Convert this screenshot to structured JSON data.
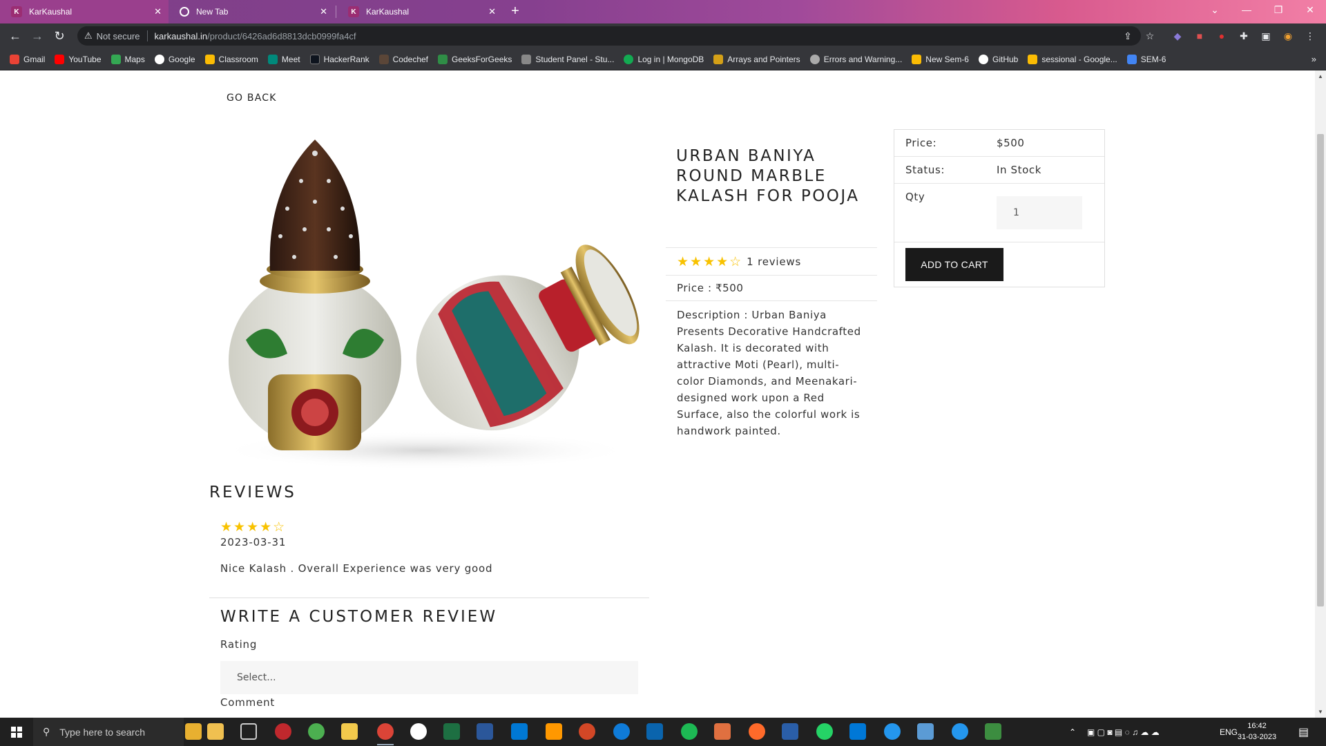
{
  "browser": {
    "tabs": [
      {
        "title": "KarKaushal",
        "active": true
      },
      {
        "title": "New Tab",
        "active": false
      },
      {
        "title": "KarKaushal",
        "active": false
      }
    ],
    "security_label": "Not secure",
    "url_host": "karkaushal.in",
    "url_path": "/product/6426ad6d8813dcb0999fa4cf",
    "bookmarks": [
      "Gmail",
      "YouTube",
      "Maps",
      "Google",
      "Classroom",
      "Meet",
      "HackerRank",
      "Codechef",
      "GeeksForGeeks",
      "Student Panel - Stu...",
      "Log in | MongoDB",
      "Arrays and Pointers",
      "Errors and Warning...",
      "New Sem-6",
      "GitHub",
      "sessional - Google...",
      "SEM-6"
    ]
  },
  "page": {
    "go_back": "GO BACK",
    "product": {
      "title": "URBAN BANIYA ROUND MARBLE KALASH FOR POOJA",
      "stars": "★★★★☆",
      "reviews_count": "1 reviews",
      "price_line": "Price : ₹500",
      "description": "Description : Urban Baniya Presents Decorative Handcrafted Kalash. It is decorated with attractive Moti (Pearl), multi-color Diamonds, and Meenakari-designed work upon a Red Surface, also the colorful work is handwork painted."
    },
    "card": {
      "price_label": "Price:",
      "price_value": "$500",
      "status_label": "Status:",
      "status_value": "In Stock",
      "qty_label": "Qty",
      "qty_value": "1",
      "add_to_cart": "ADD TO CART"
    },
    "reviews": {
      "heading": "REVIEWS",
      "items": [
        {
          "stars": "★★★★☆",
          "date": "2023-03-31",
          "comment": "Nice Kalash . Overall Experience was very good"
        }
      ]
    },
    "write_review": {
      "heading": "WRITE A CUSTOMER REVIEW",
      "rating_label": "Rating",
      "rating_placeholder": "Select...",
      "comment_label": "Comment"
    }
  },
  "taskbar": {
    "search_placeholder": "Type here to search",
    "language": "ENG",
    "time": "16:42",
    "date": "31-03-2023"
  },
  "colors": {
    "star": "#f8c200",
    "button": "#1a1a1a"
  }
}
